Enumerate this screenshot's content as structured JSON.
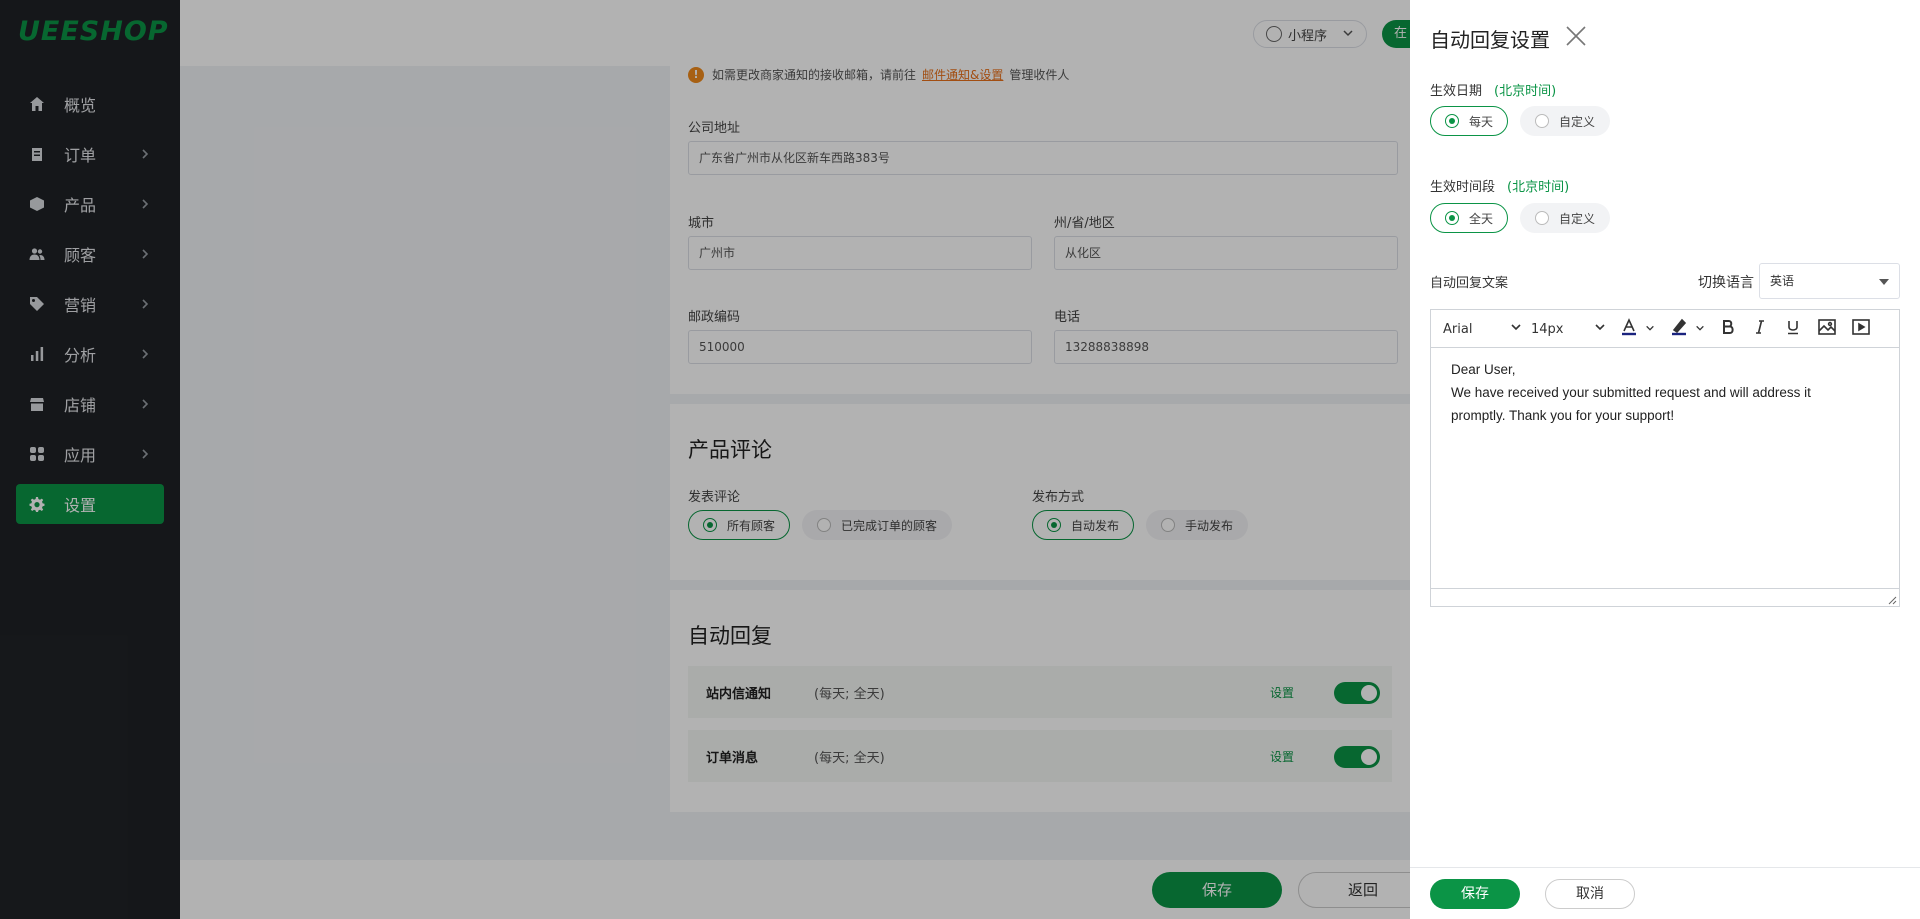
{
  "brand": {
    "logo": "UEESHOP",
    "accent": "#0b9446"
  },
  "sidebar": {
    "items": [
      {
        "label": "概览",
        "icon": "home-icon",
        "has_children": false
      },
      {
        "label": "订单",
        "icon": "clipboard-icon",
        "has_children": true
      },
      {
        "label": "产品",
        "icon": "box-icon",
        "has_children": true
      },
      {
        "label": "顾客",
        "icon": "users-icon",
        "has_children": true
      },
      {
        "label": "营销",
        "icon": "tag-icon",
        "has_children": true
      },
      {
        "label": "分析",
        "icon": "bar-chart-icon",
        "has_children": true
      },
      {
        "label": "店铺",
        "icon": "store-icon",
        "has_children": true
      },
      {
        "label": "应用",
        "icon": "apps-icon",
        "has_children": true
      },
      {
        "label": "设置",
        "icon": "gear-icon",
        "has_children": false,
        "active": true
      }
    ]
  },
  "topbar": {
    "mini_program": "小程序",
    "online": "在"
  },
  "main": {
    "notice": {
      "prefix": "如需更改商家通知的接收邮箱，请前往",
      "link": "邮件通知&设置",
      "suffix": "管理收件人"
    },
    "address": {
      "company_label": "公司地址",
      "company_value": "广东省广州市从化区新车西路383号",
      "city_label": "城市",
      "city_value": "广州市",
      "state_label": "州/省/地区",
      "state_value": "从化区",
      "zip_label": "邮政编码",
      "zip_value": "510000",
      "phone_label": "电话",
      "phone_value": "13288838898"
    },
    "reviews": {
      "title": "产品评论",
      "publish_label": "发表评论",
      "publish_options": [
        "所有顾客",
        "已完成订单的顾客"
      ],
      "method_label": "发布方式",
      "method_options": [
        "自动发布",
        "手动发布"
      ]
    },
    "auto_reply": {
      "title": "自动回复",
      "rows": [
        {
          "name": "站内信通知",
          "desc": "(每天; 全天)",
          "set": "设置",
          "enabled": true
        },
        {
          "name": "订单消息",
          "desc": "(每天; 全天)",
          "set": "设置",
          "enabled": true
        }
      ]
    },
    "footer": {
      "save": "保存",
      "back": "返回"
    }
  },
  "drawer": {
    "title": "自动回复设置",
    "date_label": "生效日期",
    "date_hint": "(北京时间)",
    "date_options": [
      "每天",
      "自定义"
    ],
    "time_label": "生效时间段",
    "time_hint": "(北京时间)",
    "time_options": [
      "全天",
      "自定义"
    ],
    "content_label": "自动回复文案",
    "lang_label": "切换语言",
    "lang_value": "英语",
    "toolbar": {
      "font": "Arial",
      "size": "14px"
    },
    "body": [
      "Dear User,",
      "We have received your submitted request and will address it",
      "promptly. Thank you for your support!"
    ],
    "save": "保存",
    "cancel": "取消"
  }
}
